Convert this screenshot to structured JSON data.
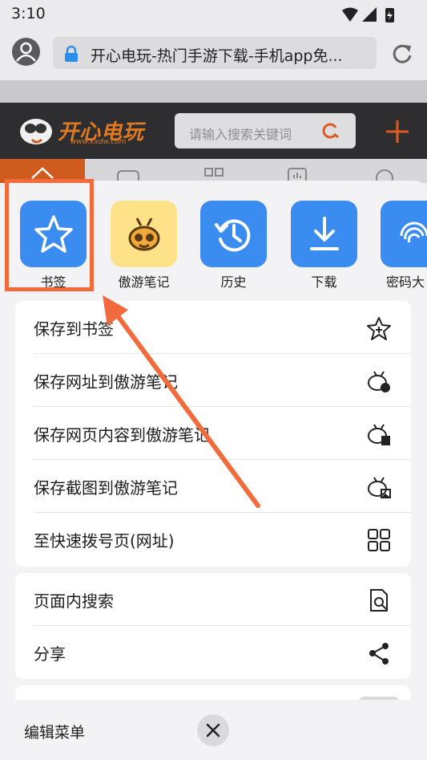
{
  "status": {
    "time": "3:10"
  },
  "browser": {
    "url": "开心电玩-热门手游下载-手机app免..."
  },
  "website": {
    "logo_text": "开心电玩",
    "logo_sub": "www.kxdw.com",
    "search_placeholder": "请输入搜索关键词"
  },
  "quick_actions": [
    {
      "label": "书签",
      "icon": "star-icon"
    },
    {
      "label": "傲游笔记",
      "icon": "bee-icon"
    },
    {
      "label": "历史",
      "icon": "history-icon"
    },
    {
      "label": "下载",
      "icon": "download-icon"
    },
    {
      "label": "密码大",
      "icon": "fingerprint-icon"
    }
  ],
  "menu_group1": [
    {
      "label": "保存到书签",
      "icon": "star-plus-icon"
    },
    {
      "label": "保存网址到傲游笔记",
      "icon": "bee-globe-icon"
    },
    {
      "label": "保存网页内容到傲游笔记",
      "icon": "bee-doc-icon"
    },
    {
      "label": "保存截图到傲游笔记",
      "icon": "bee-image-icon"
    },
    {
      "label": "至快速拨号页(网址)",
      "icon": "grid-icon"
    }
  ],
  "menu_group2": [
    {
      "label": "页面内搜索",
      "icon": "find-in-page-icon"
    },
    {
      "label": "分享",
      "icon": "share-icon"
    }
  ],
  "footer": {
    "edit_menu": "编辑菜单"
  },
  "colors": {
    "accent": "#3b8cf0",
    "highlight": "#f26b3c",
    "site_orange": "#d05b1e"
  }
}
